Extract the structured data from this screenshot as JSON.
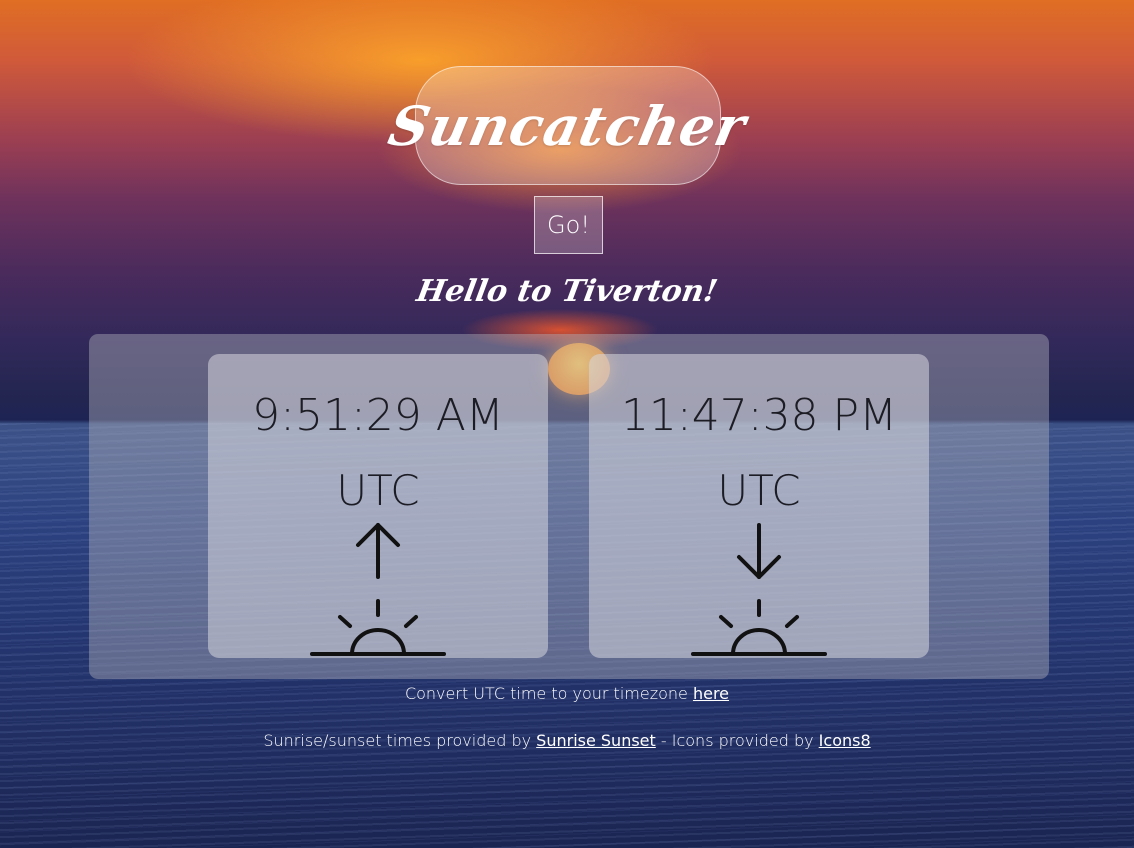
{
  "app": {
    "title": "Suncatcher",
    "go_label": "Go!",
    "greeting": "Hello to Tiverton!"
  },
  "sunrise": {
    "time": "9:51:29 AM",
    "timezone": "UTC",
    "icon": "sunrise-icon"
  },
  "sunset": {
    "time": "11:47:38 PM",
    "timezone": "UTC",
    "icon": "sunset-icon"
  },
  "footer": {
    "convert_text": "Convert UTC time to your timezone",
    "convert_link": "here",
    "credits_prefix": "Sunrise/sunset times provided by",
    "credits_link1": "Sunrise Sunset",
    "credits_middle": "- Icons provided by",
    "credits_link2": "Icons8"
  },
  "colors": {
    "sky_orange": "#e06e23",
    "sky_purple": "#6e325c",
    "ocean_blue": "#2c4280",
    "card_text": "#1c1c24"
  }
}
